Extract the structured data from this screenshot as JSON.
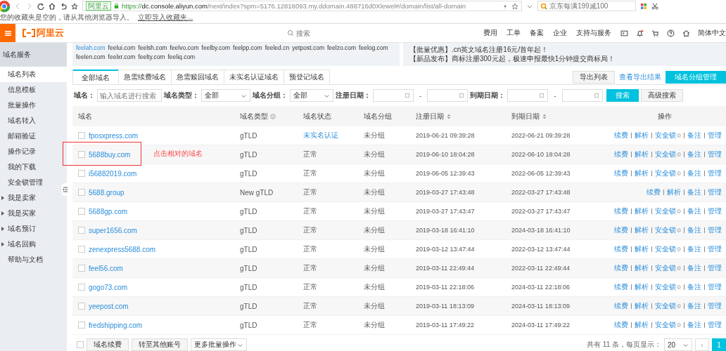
{
  "browser": {
    "tab_badge": "阿里云",
    "url_scheme": "https://",
    "url_host": "dc.console.aliyun.com",
    "url_path": "/next/index?spm=5176.12818093.my.ddomain.488716d0Xlewel#/domain/list/all-domain",
    "search": {
      "placeholder": "京东每满199减100"
    },
    "bookmarks_message": "您的收藏夹是空的，请从其他浏览器导入。",
    "bookmarks_link": "立即导入收藏夹..."
  },
  "header": {
    "logo": "阿里云",
    "search": {
      "placeholder": "搜索"
    },
    "nav": [
      "费用",
      "工单",
      "备案",
      "企业",
      "支持与服务"
    ],
    "language": "简体中文"
  },
  "sidebar": {
    "title": "域名服务",
    "items": [
      {
        "label": "域名列表",
        "selected": true,
        "kind": "leaf"
      },
      {
        "label": "信息模板",
        "selected": false,
        "kind": "leaf"
      },
      {
        "label": "批量操作",
        "selected": false,
        "kind": "leaf"
      },
      {
        "label": "域名转入",
        "selected": false,
        "kind": "leaf"
      },
      {
        "label": "邮箱验证",
        "selected": false,
        "kind": "leaf"
      },
      {
        "label": "操作记录",
        "selected": false,
        "kind": "leaf"
      },
      {
        "label": "我的下载",
        "selected": false,
        "kind": "leaf"
      },
      {
        "label": "安全锁管理",
        "selected": false,
        "kind": "leaf"
      },
      {
        "label": "我是卖家",
        "selected": false,
        "kind": "group",
        "expanded": false
      },
      {
        "label": "我是买家",
        "selected": false,
        "kind": "group",
        "expanded": false
      },
      {
        "label": "域名预订",
        "selected": false,
        "kind": "group",
        "expanded": false
      },
      {
        "label": "域名回购",
        "selected": false,
        "kind": "group",
        "expanded": false
      },
      {
        "label": "帮助与文档",
        "selected": false,
        "kind": "leaf"
      }
    ]
  },
  "banner": {
    "domains": [
      {
        "label": "feelah.com",
        "selected": true
      },
      {
        "label": "feelui.com",
        "selected": false
      },
      {
        "label": "feelsh.com",
        "selected": false
      },
      {
        "label": "feelvo.com",
        "selected": false
      },
      {
        "label": "feelby.com",
        "selected": false
      },
      {
        "label": "feelpp.com",
        "selected": false
      },
      {
        "label": "feeled.cn",
        "selected": false
      },
      {
        "label": "yetpost.com",
        "selected": false
      },
      {
        "label": "feelzo.com",
        "selected": false
      },
      {
        "label": "feelog.com",
        "selected": false
      },
      {
        "label": "feelen.com",
        "selected": false
      },
      {
        "label": "feelxr.com",
        "selected": false
      },
      {
        "label": "feelty.com",
        "selected": false
      },
      {
        "label": "feeliq.com",
        "selected": false
      }
    ],
    "notices": [
      "【批量优惠】.cn英文域名注册16元/首年起！",
      "【新品发布】商标注册300元起，极速申报最快1分钟提交商标局！"
    ]
  },
  "tabs": [
    {
      "label": "全部域名",
      "selected": true
    },
    {
      "label": "急需续费域名",
      "selected": false
    },
    {
      "label": "急需赎回域名",
      "selected": false
    },
    {
      "label": "未实名认证域名",
      "selected": false
    },
    {
      "label": "预登记域名",
      "selected": false
    }
  ],
  "actions": {
    "export": "导出列表",
    "view_export": "查看导出结果",
    "group_manage": "域名分组管理"
  },
  "filters": {
    "domain_label": "域名：",
    "domain": {
      "placeholder": "输入域名进行搜索"
    },
    "type_label": "域名类型：",
    "type_value": "全部",
    "group_label": "域名分组：",
    "group_value": "全部",
    "reg_label": "注册日期：",
    "exp_label": "到期日期：",
    "dash": "-",
    "search": "搜索",
    "advanced": "高级搜索"
  },
  "table": {
    "columns": [
      {
        "label": "域名",
        "kind": "plain"
      },
      {
        "label": "域名类型",
        "kind": "info"
      },
      {
        "label": "域名状态",
        "kind": "plain"
      },
      {
        "label": "域名分组",
        "kind": "plain"
      },
      {
        "label": "注册日期",
        "kind": "sort"
      },
      {
        "label": "到期日期",
        "kind": "sort"
      },
      {
        "label": "操作",
        "kind": "plain"
      }
    ],
    "rows": [
      {
        "checked": false,
        "domain": "fposxpress.com",
        "type": "gTLD",
        "status": {
          "label": "未实名认证",
          "kind": "link"
        },
        "group": "未分组",
        "registered": "2019-06-21 09:39:28",
        "expires": "2022-06-21 09:39:28",
        "ops": [
          {
            "label": "续费",
            "info": false
          },
          {
            "label": "解析",
            "info": false
          },
          {
            "label": "安全锁",
            "info": true
          },
          {
            "label": "备注",
            "info": false
          },
          {
            "label": "管理",
            "info": false
          }
        ]
      },
      {
        "checked": false,
        "domain": "5688buy.com",
        "type": "gTLD",
        "status": {
          "label": "正常",
          "kind": "text"
        },
        "group": "未分组",
        "registered": "2019-06-10 18:04:28",
        "expires": "2022-06-10 18:04:28",
        "ops": [
          {
            "label": "续费",
            "info": false
          },
          {
            "label": "解析",
            "info": false
          },
          {
            "label": "安全锁",
            "info": true
          },
          {
            "label": "备注",
            "info": false
          },
          {
            "label": "管理",
            "info": false
          }
        ]
      },
      {
        "checked": false,
        "domain": "i56882019.com",
        "type": "gTLD",
        "status": {
          "label": "正常",
          "kind": "text"
        },
        "group": "未分组",
        "registered": "2019-06-05 12:39:43",
        "expires": "2022-06-05 12:39:43",
        "ops": [
          {
            "label": "续费",
            "info": false
          },
          {
            "label": "解析",
            "info": false
          },
          {
            "label": "安全锁",
            "info": true
          },
          {
            "label": "备注",
            "info": false
          },
          {
            "label": "管理",
            "info": false
          }
        ]
      },
      {
        "checked": false,
        "domain": "5688.group",
        "type": "New gTLD",
        "status": {
          "label": "正常",
          "kind": "text"
        },
        "group": "未分组",
        "registered": "2019-03-27 17:43:48",
        "expires": "2022-03-27 17:43:48",
        "ops": [
          {
            "label": "续费",
            "info": false
          },
          {
            "label": "解析",
            "info": false
          },
          {
            "label": "备注",
            "info": false
          },
          {
            "label": "管理",
            "info": false
          }
        ]
      },
      {
        "checked": false,
        "domain": "5688gp.com",
        "type": "gTLD",
        "status": {
          "label": "正常",
          "kind": "text"
        },
        "group": "未分组",
        "registered": "2019-03-27 17:43:47",
        "expires": "2022-03-27 17:43:47",
        "ops": [
          {
            "label": "续费",
            "info": false
          },
          {
            "label": "解析",
            "info": false
          },
          {
            "label": "安全锁",
            "info": true
          },
          {
            "label": "备注",
            "info": false
          },
          {
            "label": "管理",
            "info": false
          }
        ]
      },
      {
        "checked": false,
        "domain": "super1656.com",
        "type": "gTLD",
        "status": {
          "label": "正常",
          "kind": "text"
        },
        "group": "未分组",
        "registered": "2019-03-18 16:41:10",
        "expires": "2024-03-18 16:41:10",
        "ops": [
          {
            "label": "续费",
            "info": false
          },
          {
            "label": "解析",
            "info": false
          },
          {
            "label": "安全锁",
            "info": true
          },
          {
            "label": "备注",
            "info": false
          },
          {
            "label": "管理",
            "info": false
          }
        ]
      },
      {
        "checked": false,
        "domain": "zenexpress5688.com",
        "type": "gTLD",
        "status": {
          "label": "正常",
          "kind": "text"
        },
        "group": "未分组",
        "registered": "2019-03-12 13:47:44",
        "expires": "2022-03-12 13:47:44",
        "ops": [
          {
            "label": "续费",
            "info": false
          },
          {
            "label": "解析",
            "info": false
          },
          {
            "label": "安全锁",
            "info": true
          },
          {
            "label": "备注",
            "info": false
          },
          {
            "label": "管理",
            "info": false
          }
        ]
      },
      {
        "checked": false,
        "domain": "feel56.com",
        "type": "gTLD",
        "status": {
          "label": "正常",
          "kind": "text"
        },
        "group": "未分组",
        "registered": "2019-03-11 22:49:44",
        "expires": "2022-03-11 22:49:44",
        "ops": [
          {
            "label": "续费",
            "info": false
          },
          {
            "label": "解析",
            "info": false
          },
          {
            "label": "安全锁",
            "info": true
          },
          {
            "label": "备注",
            "info": false
          },
          {
            "label": "管理",
            "info": false
          }
        ]
      },
      {
        "checked": false,
        "domain": "gogo73.com",
        "type": "gTLD",
        "status": {
          "label": "正常",
          "kind": "text"
        },
        "group": "未分组",
        "registered": "2019-03-11 22:18:06",
        "expires": "2024-03-11 22:18:06",
        "ops": [
          {
            "label": "续费",
            "info": false
          },
          {
            "label": "解析",
            "info": false
          },
          {
            "label": "安全锁",
            "info": true
          },
          {
            "label": "备注",
            "info": false
          },
          {
            "label": "管理",
            "info": false
          }
        ]
      },
      {
        "checked": false,
        "domain": "yeepost.com",
        "type": "gTLD",
        "status": {
          "label": "正常",
          "kind": "text"
        },
        "group": "未分组",
        "registered": "2019-03-11 18:13:09",
        "expires": "2024-03-11 18:13:09",
        "ops": [
          {
            "label": "续费",
            "info": false
          },
          {
            "label": "解析",
            "info": false
          },
          {
            "label": "安全锁",
            "info": true
          },
          {
            "label": "备注",
            "info": false
          },
          {
            "label": "管理",
            "info": false
          }
        ]
      },
      {
        "checked": false,
        "domain": "fredshipping.com",
        "type": "gTLD",
        "status": {
          "label": "正常",
          "kind": "text"
        },
        "group": "未分组",
        "registered": "2019-03-11 17:49:22",
        "expires": "2024-03-11 17:49:22",
        "ops": [
          {
            "label": "续费",
            "info": false
          },
          {
            "label": "解析",
            "info": false
          },
          {
            "label": "安全锁",
            "info": true
          },
          {
            "label": "备注",
            "info": false
          },
          {
            "label": "管理",
            "info": false
          }
        ]
      }
    ]
  },
  "footer": {
    "select_all": {
      "checked": false
    },
    "renew": "域名续费",
    "transfer": "转至其他账号",
    "more": "更多批量操作",
    "total": "共有 11 条，每页显示：",
    "page_size": "20",
    "prev": "‹",
    "pages": [
      {
        "label": "1",
        "selected": true
      }
    ]
  },
  "annotation": {
    "text": "点击相对的域名"
  }
}
